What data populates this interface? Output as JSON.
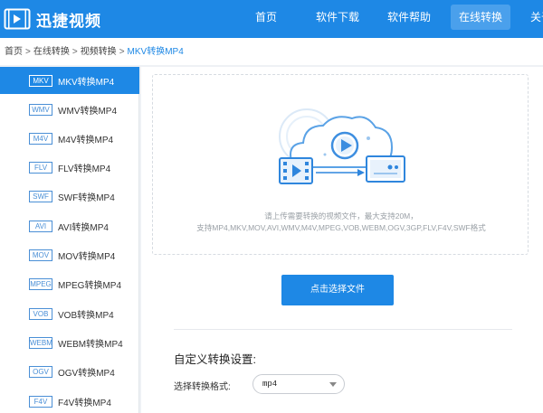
{
  "header": {
    "logo_text": "迅捷视频",
    "nav": [
      {
        "label": "首页"
      },
      {
        "label": "软件下载"
      },
      {
        "label": "软件帮助"
      },
      {
        "label": "在线转换",
        "active": true
      },
      {
        "label": "关于"
      }
    ]
  },
  "breadcrumb": {
    "items": [
      "首页",
      "在线转换",
      "视频转换"
    ],
    "separator": ">",
    "current": "MKV转换MP4"
  },
  "sidebar": {
    "items": [
      {
        "badge": "MKV",
        "label": "MKV转换MP4",
        "active": true
      },
      {
        "badge": "WMV",
        "label": "WMV转换MP4"
      },
      {
        "badge": "M4V",
        "label": "M4V转换MP4"
      },
      {
        "badge": "FLV",
        "label": "FLV转换MP4"
      },
      {
        "badge": "SWF",
        "label": "SWF转换MP4"
      },
      {
        "badge": "AVI",
        "label": "AVI转换MP4"
      },
      {
        "badge": "MOV",
        "label": "MOV转换MP4"
      },
      {
        "badge": "MPEG",
        "label": "MPEG转换MP4"
      },
      {
        "badge": "VOB",
        "label": "VOB转换MP4"
      },
      {
        "badge": "WEBM",
        "label": "WEBM转换MP4"
      },
      {
        "badge": "OGV",
        "label": "OGV转换MP4"
      },
      {
        "badge": "F4V",
        "label": "F4V转换MP4"
      }
    ]
  },
  "upload": {
    "hint_line1": "请上传需要转换的视频文件，最大支持20M，",
    "hint_line2": "支持MP4,MKV,MOV,AVI,WMV,M4V,MPEG,VOB,WEBM,OGV,3GP,FLV,F4V,SWF格式",
    "button_label": "点击选择文件"
  },
  "settings": {
    "title": "自定义转换设置:",
    "format_label": "选择转换格式:",
    "format_value": "mp4"
  },
  "colors": {
    "brand": "#1e88e5",
    "nav_active": "#4aa0ec"
  }
}
